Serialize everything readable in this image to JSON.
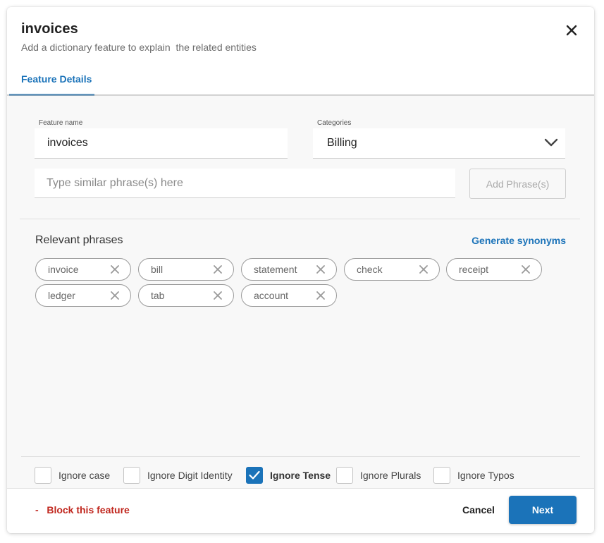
{
  "dialog": {
    "title": "invoices",
    "subtitle": "Add a dictionary feature to explain  the related entities",
    "close_icon": "close-icon",
    "tabs": [
      {
        "label": "Feature Details",
        "active": true
      }
    ]
  },
  "form": {
    "feature_name": {
      "label": "Feature name",
      "value": "invoices"
    },
    "categories": {
      "label": "Categories",
      "value": "Billing",
      "icon": "chevron-down-icon"
    },
    "phrase_input": {
      "placeholder": "Type similar phrase(s) here",
      "value": ""
    },
    "add_phrase_label": "Add Phrase(s)"
  },
  "phrases": {
    "label": "Relevant phrases",
    "generate_label": "Generate synonyms",
    "items": [
      "invoice",
      "bill",
      "statement",
      "check",
      "receipt",
      "ledger",
      "tab",
      "account"
    ]
  },
  "options": [
    {
      "label": "Ignore case",
      "checked": false
    },
    {
      "label": "Ignore Digit Identity",
      "checked": false
    },
    {
      "label": "Ignore Tense",
      "checked": true
    },
    {
      "label": "Ignore Plurals",
      "checked": false
    },
    {
      "label": "Ignore Typos",
      "checked": false
    }
  ],
  "footer": {
    "block_label": "-   Block this feature",
    "cancel_label": "Cancel",
    "next_label": "Next"
  },
  "colors": {
    "accent": "#1b73b9",
    "danger": "#c0261d",
    "background": "#f8f8f8"
  }
}
